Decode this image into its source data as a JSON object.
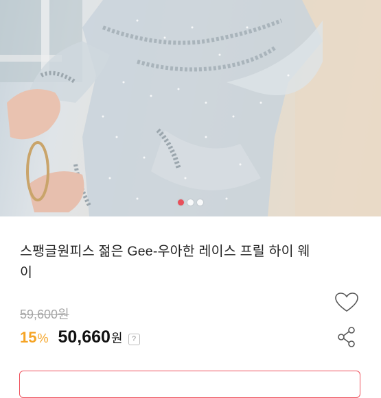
{
  "product": {
    "title_line1": "스팽글원피스 젊은 Gee-우아한 레이스 프릴 하이 웨",
    "title_line2": "이",
    "original_price": "59,600원",
    "discount_value": "15",
    "discount_unit": "%",
    "price_value": "50,660",
    "price_unit": "원",
    "help_mark": "?"
  },
  "gallery": {
    "image_count": 3,
    "active_index": 0
  },
  "icons": {
    "wishlist": "heart-icon",
    "share": "share-icon",
    "help": "question-icon"
  },
  "colors": {
    "accent": "#e8505b",
    "discount": "#f5a425",
    "strikethrough": "#a6a6a6"
  }
}
